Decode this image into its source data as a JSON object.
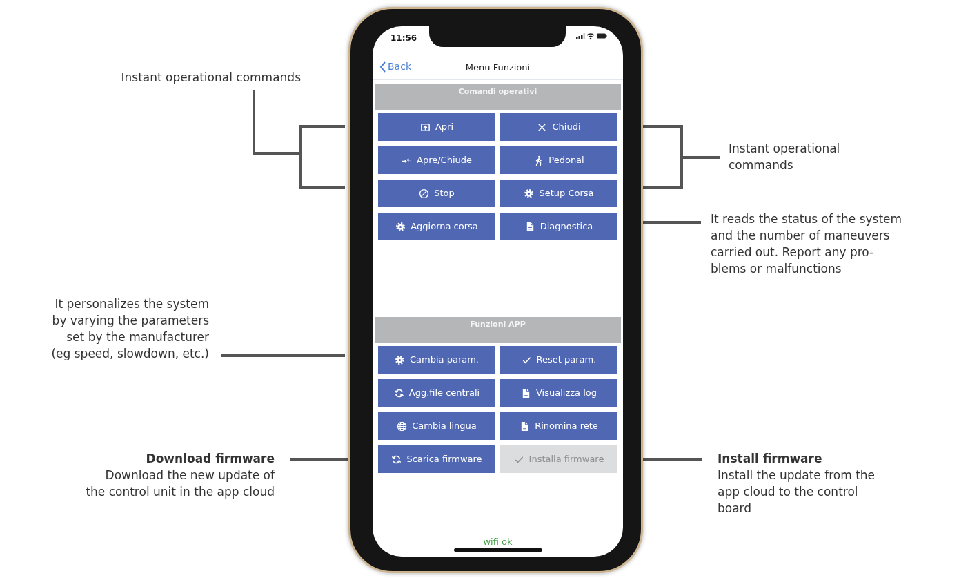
{
  "status_bar": {
    "time": "11:56"
  },
  "nav": {
    "back": "Back",
    "title": "Menu Funzioni"
  },
  "sections": [
    {
      "title": "Comandi operativi",
      "buttons": [
        {
          "label": "Apri",
          "kind": "open",
          "disabled": false
        },
        {
          "label": "Chiudi",
          "kind": "close",
          "disabled": false
        },
        {
          "label": "Apre/Chiude",
          "kind": "swap",
          "disabled": false
        },
        {
          "label": "Pedonal",
          "kind": "walk",
          "disabled": false
        },
        {
          "label": "Stop",
          "kind": "stop",
          "disabled": false
        },
        {
          "label": "Setup Corsa",
          "kind": "gear",
          "disabled": false
        },
        {
          "label": "Aggiorna corsa",
          "kind": "gear",
          "disabled": false
        },
        {
          "label": "Diagnostica",
          "kind": "document",
          "disabled": false
        }
      ]
    },
    {
      "title": "Funzioni APP",
      "buttons": [
        {
          "label": "Cambia param.",
          "kind": "gear",
          "disabled": false
        },
        {
          "label": "Reset param.",
          "kind": "check",
          "disabled": false
        },
        {
          "label": "Agg.file centrali",
          "kind": "sync",
          "disabled": false
        },
        {
          "label": "Visualizza log",
          "kind": "document",
          "disabled": false
        },
        {
          "label": "Cambia lingua",
          "kind": "globe",
          "disabled": false
        },
        {
          "label": "Rinomina rete",
          "kind": "document",
          "disabled": false
        },
        {
          "label": "Scarica firmware",
          "kind": "sync",
          "disabled": false
        },
        {
          "label": "Installa firmware",
          "kind": "check",
          "disabled": true
        }
      ]
    }
  ],
  "footer": {
    "status": "wifi ok"
  },
  "annotations": [
    {
      "lines": [
        "Instant operational commands"
      ]
    },
    {
      "lines": [
        "Instant operational",
        "commands"
      ]
    },
    {
      "lines": [
        "It reads the status of the system",
        "and the number of maneuvers",
        "carried out. Report any pro-",
        "blems or malfunctions"
      ]
    },
    {
      "lines": [
        "It personalizes the system",
        "by varying the parameters",
        "set by the manufacturer",
        "(eg speed, slowdown, etc.)"
      ]
    },
    {
      "heading": "Download firmware",
      "lines": [
        "Download the new update of",
        "the control unit in the app cloud"
      ]
    },
    {
      "heading": "Install firmware",
      "lines": [
        "Install the update from the",
        "app cloud to the control",
        "board"
      ]
    }
  ]
}
